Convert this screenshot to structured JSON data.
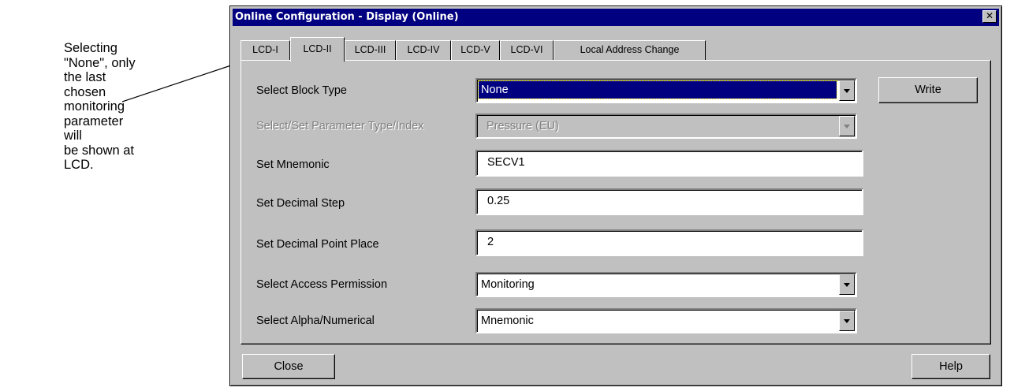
{
  "annotation": {
    "text": "Selecting\n\"None\", only\nthe last chosen\nmonitoring\nparameter will\nbe shown at\nLCD."
  },
  "window": {
    "title": "Online Configuration - Display  (Online)",
    "close_glyph": "✕"
  },
  "tabs": [
    {
      "label": "LCD-I"
    },
    {
      "label": "LCD-II"
    },
    {
      "label": "LCD-III"
    },
    {
      "label": "LCD-IV"
    },
    {
      "label": "LCD-V"
    },
    {
      "label": "LCD-VI"
    },
    {
      "label": "Local Address Change"
    }
  ],
  "active_tab": "LCD-II",
  "form": {
    "block_type": {
      "label": "Select Block Type",
      "value": "None"
    },
    "parameter_type": {
      "label": "Select/Set Parameter Type/Index",
      "value": "Pressure (EU)"
    },
    "mnemonic": {
      "label": "Set Mnemonic",
      "value": "SECV1"
    },
    "decimal_step": {
      "label": "Set Decimal Step",
      "value": "0.25"
    },
    "decimal_point": {
      "label": "Set Decimal Point Place",
      "value": "2"
    },
    "access_permission": {
      "label": "Select Access Permission",
      "value": "Monitoring"
    },
    "alpha_numerical": {
      "label": "Select Alpha/Numerical",
      "value": "Mnemonic"
    }
  },
  "buttons": {
    "write": "Write",
    "close": "Close",
    "help": "Help"
  },
  "colors": {
    "titlebar": "#000080",
    "face": "#c0c0c0",
    "selection": "#000080"
  }
}
